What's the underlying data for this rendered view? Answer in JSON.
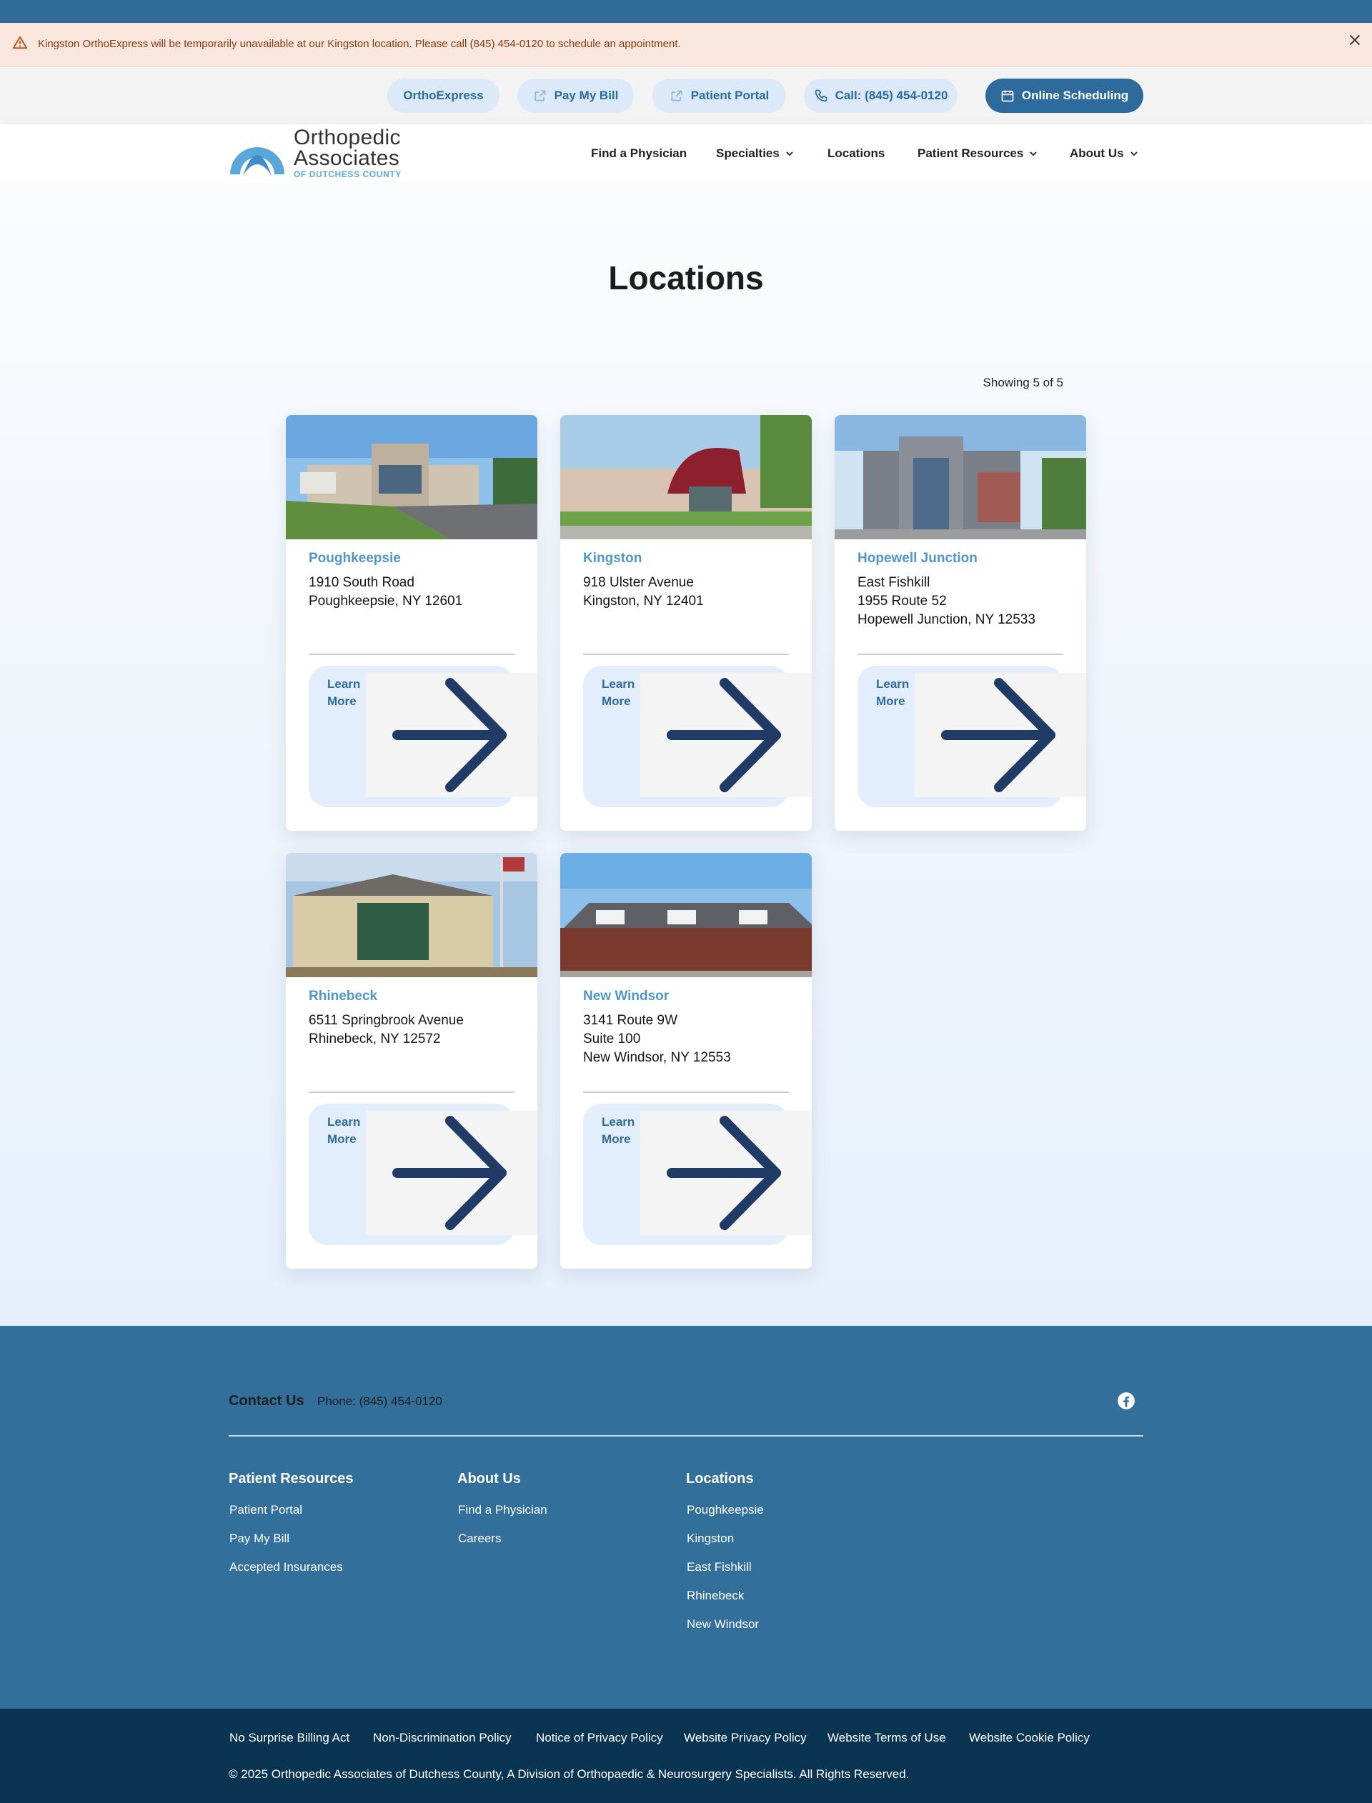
{
  "alert": {
    "message": "Kingston OrthoExpress will be temporarily unavailable at our Kingston location. Please call (845) 454-0120 to schedule an appointment."
  },
  "utility": {
    "orthoexpress": "OrthoExpress",
    "pay_bill": "Pay My Bill",
    "patient_portal": "Patient Portal",
    "call": "Call: (845) 454-0120",
    "online_scheduling": "Online Scheduling"
  },
  "logo": {
    "line1": "Orthopedic",
    "line2": "Associates",
    "line3": "OF DUTCHESS COUNTY"
  },
  "nav": {
    "find_physician": "Find a Physician",
    "specialties": "Specialties",
    "locations": "Locations",
    "patient_resources": "Patient Resources",
    "about_us": "About Us"
  },
  "page": {
    "title": "Locations",
    "showing": "Showing 5 of 5"
  },
  "locations": [
    {
      "name": "Poughkeepsie",
      "lines": [
        "1910 South Road",
        "Poughkeepsie, NY 12601"
      ],
      "learn_more": "Learn More"
    },
    {
      "name": "Kingston",
      "lines": [
        "918 Ulster Avenue",
        "Kingston, NY 12401"
      ],
      "learn_more": "Learn More"
    },
    {
      "name": "Hopewell Junction",
      "lines": [
        "East Fishkill",
        "1955 Route 52",
        "Hopewell Junction, NY 12533"
      ],
      "learn_more": "Learn More"
    },
    {
      "name": "Rhinebeck",
      "lines": [
        "6511 Springbrook Avenue",
        "Rhinebeck, NY 12572"
      ],
      "learn_more": "Learn More"
    },
    {
      "name": "New Windsor",
      "lines": [
        "3141 Route 9W",
        "Suite 100",
        "New Windsor, NY 12553"
      ],
      "learn_more": "Learn More"
    }
  ],
  "footer": {
    "contact_title": "Contact Us",
    "phone": "Phone: (845) 454-0120",
    "patient_resources": {
      "heading": "Patient Resources",
      "links": [
        "Patient Portal",
        "Pay My Bill",
        "Accepted Insurances"
      ]
    },
    "about_us": {
      "heading": "About Us",
      "links": [
        "Find a Physician",
        "Careers"
      ]
    },
    "locations": {
      "heading": "Locations",
      "links": [
        "Poughkeepsie",
        "Kingston",
        "East Fishkill",
        "Rhinebeck",
        "New Windsor"
      ]
    }
  },
  "bottom": {
    "links": [
      "No Surprise Billing Act",
      "Non-Discrimination Policy",
      "Notice of Privacy Policy",
      "Website Privacy Policy",
      "Website Terms of Use",
      "Website Cookie Policy"
    ],
    "copyright": "© 2025 Orthopedic Associates of Dutchess County, A Division of Orthopaedic & Neurosurgery Specialists. All Rights Reserved."
  },
  "icons": {
    "alert": "warning-triangle-icon",
    "close": "close-icon",
    "external": "external-link-icon",
    "phone": "phone-icon",
    "calendar": "calendar-icon",
    "chevron": "chevron-down-icon",
    "arrow": "arrow-right-icon",
    "facebook": "facebook-icon"
  },
  "colors": {
    "brand": "#306b97",
    "brand_light": "#dbe9f8",
    "link_blue": "#4f97c9",
    "arrow_navy": "#1f3b66",
    "footer_bg": "#336f9b",
    "bottom_bg": "#0a3552",
    "alert_bg": "#f9e6dc"
  }
}
